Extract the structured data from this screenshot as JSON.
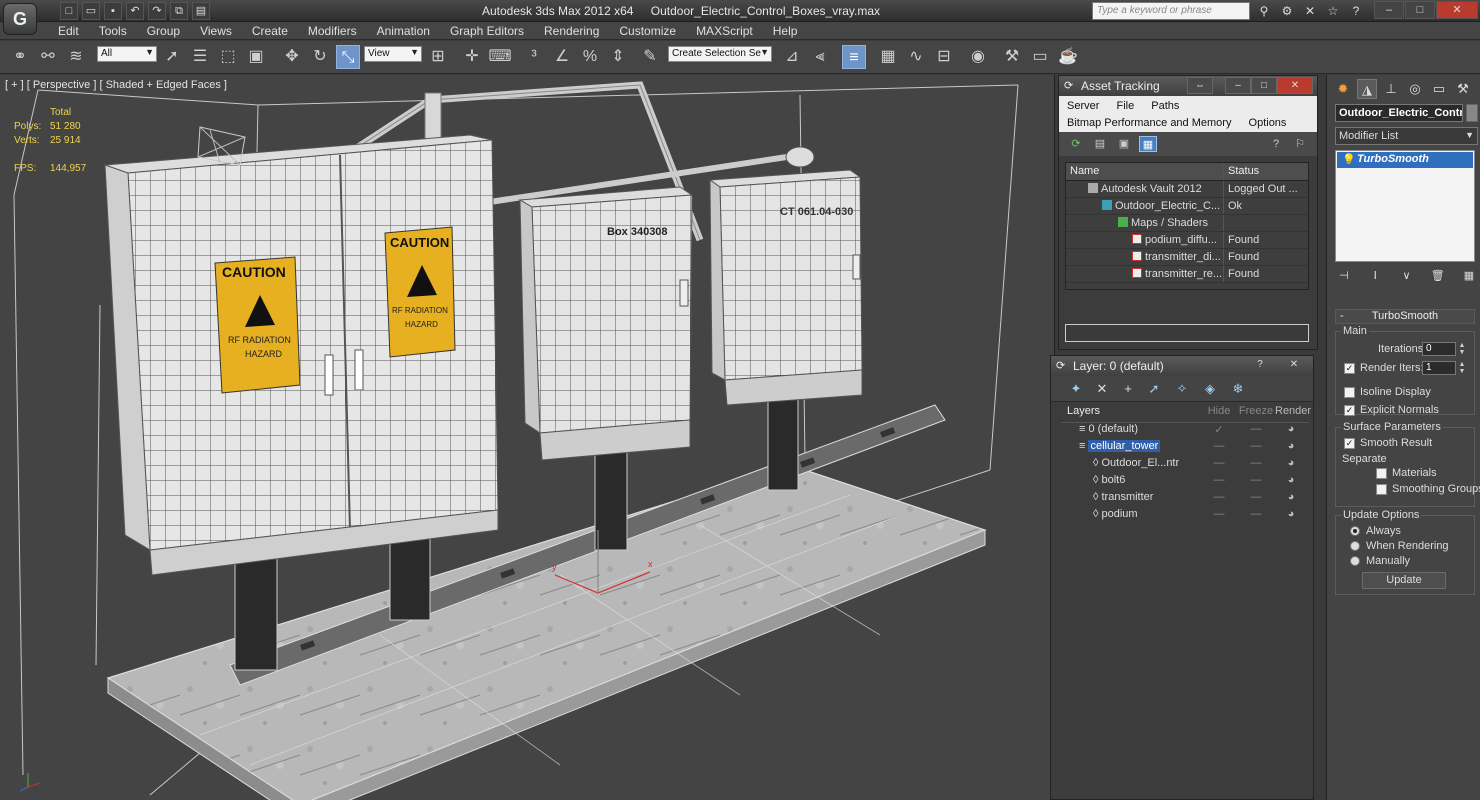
{
  "app": {
    "logo_glyph": "G",
    "title": "Autodesk 3ds Max  2012 x64",
    "file": "Outdoor_Electric_Control_Boxes_vray.max",
    "search_placeholder": "Type a keyword or phrase"
  },
  "menu": [
    "Edit",
    "Tools",
    "Group",
    "Views",
    "Create",
    "Modifiers",
    "Animation",
    "Graph Editors",
    "Rendering",
    "Customize",
    "MAXScript",
    "Help"
  ],
  "toolbar": {
    "selection_filter": "All",
    "ref_coord": "View",
    "named_selection": "Create Selection Se"
  },
  "viewport": {
    "label": "[ + ] [ Perspective ] [ Shaded + Edged Faces ]",
    "stats_header": "Total",
    "polys_label": "Polys:",
    "polys_value": "51 280",
    "verts_label": "Verts:",
    "verts_value": "25 914",
    "fps_label": "FPS:",
    "fps_value": "144,957",
    "sign_caution": "CAUTION",
    "sign_hazard1": "RF RADIATION",
    "sign_hazard2": "HAZARD",
    "box_label_1": "Box 340308",
    "box_label_2": "CT 061.04-030"
  },
  "asset_tracking": {
    "title": "Asset Tracking",
    "menu_row1": [
      "Server",
      "File",
      "Paths"
    ],
    "menu_row2": [
      "Bitmap Performance and Memory",
      "Options"
    ],
    "col_name": "Name",
    "col_status": "Status",
    "rows": [
      {
        "name": "Autodesk Vault 2012",
        "status": "Logged Out ..."
      },
      {
        "name": "Outdoor_Electric_C...",
        "status": "Ok"
      },
      {
        "name": "Maps / Shaders",
        "status": ""
      },
      {
        "name": "podium_diffu...",
        "status": "Found"
      },
      {
        "name": "transmitter_di...",
        "status": "Found"
      },
      {
        "name": "transmitter_re...",
        "status": "Found"
      }
    ]
  },
  "layers": {
    "title": "Layer: 0 (default)",
    "col_layers": "Layers",
    "col_hide": "Hide",
    "col_freeze": "Freeze",
    "col_render": "Render",
    "rows": [
      {
        "name": "0 (default)"
      },
      {
        "name": "cellular_tower"
      },
      {
        "name": "Outdoor_El...ntr"
      },
      {
        "name": "bolt6"
      },
      {
        "name": "transmitter"
      },
      {
        "name": "podium"
      }
    ]
  },
  "command_panel": {
    "object_name": "Outdoor_Electric_Control",
    "modifier_list": "Modifier List",
    "modifier": "TurboSmooth",
    "rollout_title": "TurboSmooth",
    "main_group": "Main",
    "iterations_label": "Iterations:",
    "iterations_value": "0",
    "render_iters_label": "Render Iters:",
    "render_iters_value": "1",
    "isoline_label": "Isoline Display",
    "explicit_normals_label": "Explicit Normals",
    "surface_group": "Surface Parameters",
    "smooth_result_label": "Smooth Result",
    "separate_label": "Separate",
    "materials_label": "Materials",
    "smoothing_groups_label": "Smoothing Groups",
    "update_group": "Update Options",
    "always_label": "Always",
    "when_rendering_label": "When Rendering",
    "manually_label": "Manually",
    "update_button": "Update"
  },
  "colors": {
    "selection_blue": "#2f6fbe",
    "stats_yellow": "#f0d34a",
    "close_red": "#b83b2e"
  }
}
